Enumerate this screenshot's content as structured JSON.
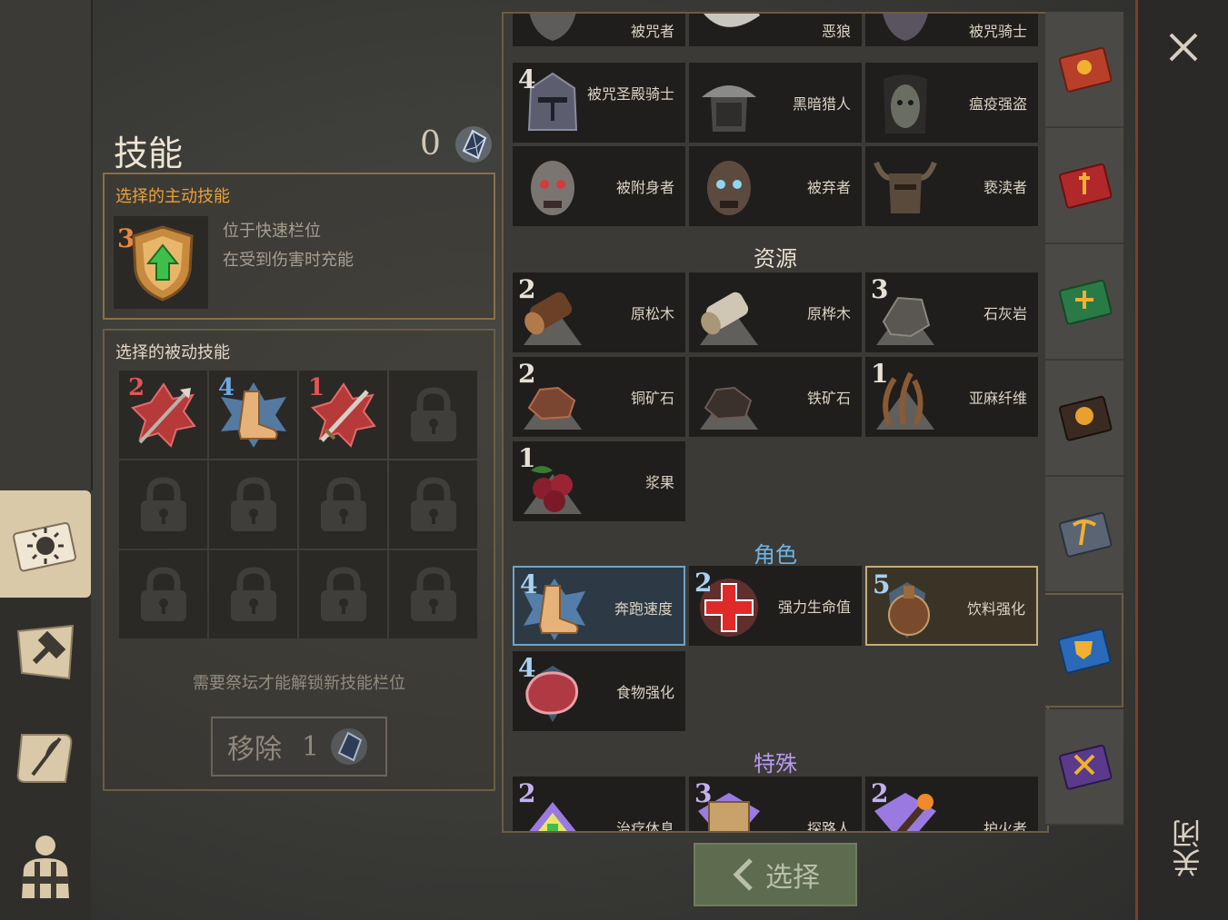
{
  "skills": {
    "title": "技能",
    "points": "0",
    "active_title": "选择的主动技能",
    "active_level": "3",
    "active_desc_1": "位于快速栏位",
    "active_desc_2": "在受到伤害时充能",
    "passive_title": "选择的被动技能",
    "passive_slots": [
      {
        "level": "2",
        "icon": "spear-skill-icon",
        "color": "#e05555"
      },
      {
        "level": "4",
        "icon": "boot-speed-icon",
        "color": "#6fa7e0"
      },
      {
        "level": "1",
        "icon": "sword-skill-icon",
        "color": "#e05555"
      }
    ],
    "unlock_note": "需要祭坛才能解锁新技能栏位",
    "remove_label": "移除",
    "remove_count": "1"
  },
  "list": {
    "enemies_cut": [
      "被咒者",
      "恶狼",
      "被咒骑士"
    ],
    "enemies": [
      {
        "level": "4",
        "label": "被咒圣殿骑士"
      },
      {
        "level": "",
        "label": "黑暗猎人"
      },
      {
        "level": "",
        "label": "瘟疫强盗"
      },
      {
        "level": "",
        "label": "被附身者"
      },
      {
        "level": "",
        "label": "被弃者"
      },
      {
        "level": "",
        "label": "亵渎者"
      }
    ],
    "resources_head": "资源",
    "resources": [
      {
        "level": "2",
        "label": "原松木"
      },
      {
        "level": "",
        "label": "原桦木"
      },
      {
        "level": "3",
        "label": "石灰岩"
      },
      {
        "level": "2",
        "label": "铜矿石"
      },
      {
        "level": "",
        "label": "铁矿石"
      },
      {
        "level": "1",
        "label": "亚麻纤维"
      },
      {
        "level": "1",
        "label": "浆果"
      }
    ],
    "character_head": "角色",
    "character": [
      {
        "level": "4",
        "label": "奔跑速度"
      },
      {
        "level": "2",
        "label": "强力生命值"
      },
      {
        "level": "5",
        "label": "饮料强化"
      },
      {
        "level": "4",
        "label": "食物强化"
      }
    ],
    "special_head": "特殊",
    "special": [
      {
        "level": "2",
        "label": "治疗休息"
      },
      {
        "level": "3",
        "label": "探路人"
      },
      {
        "level": "2",
        "label": "护火者"
      }
    ]
  },
  "select_label": "选择",
  "close_label": "关闭",
  "colors": {
    "resources_head": "#e8e0d0",
    "character_head": "#6fb4e6",
    "special_head": "#b79af0",
    "active_accent": "#e9a13c"
  }
}
